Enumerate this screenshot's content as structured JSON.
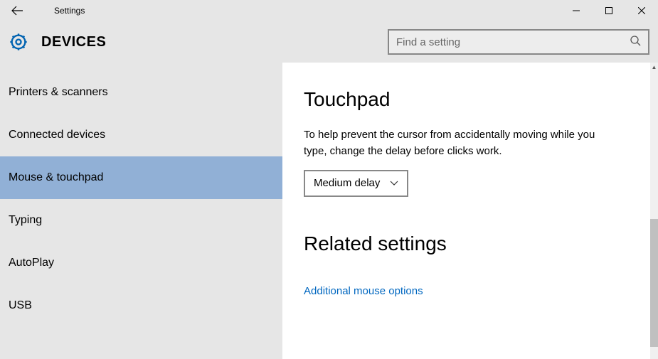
{
  "window": {
    "title": "Settings"
  },
  "header": {
    "title": "DEVICES",
    "search_placeholder": "Find a setting"
  },
  "sidebar": {
    "items": [
      {
        "label": "Printers & scanners",
        "selected": false
      },
      {
        "label": "Connected devices",
        "selected": false
      },
      {
        "label": "Mouse & touchpad",
        "selected": true
      },
      {
        "label": "Typing",
        "selected": false
      },
      {
        "label": "AutoPlay",
        "selected": false
      },
      {
        "label": "USB",
        "selected": false
      }
    ]
  },
  "content": {
    "section1_heading": "Touchpad",
    "section1_desc": "To help prevent the cursor from accidentally moving while you type, change the delay before clicks work.",
    "delay_value": "Medium delay",
    "section2_heading": "Related settings",
    "link_label": "Additional mouse options"
  }
}
